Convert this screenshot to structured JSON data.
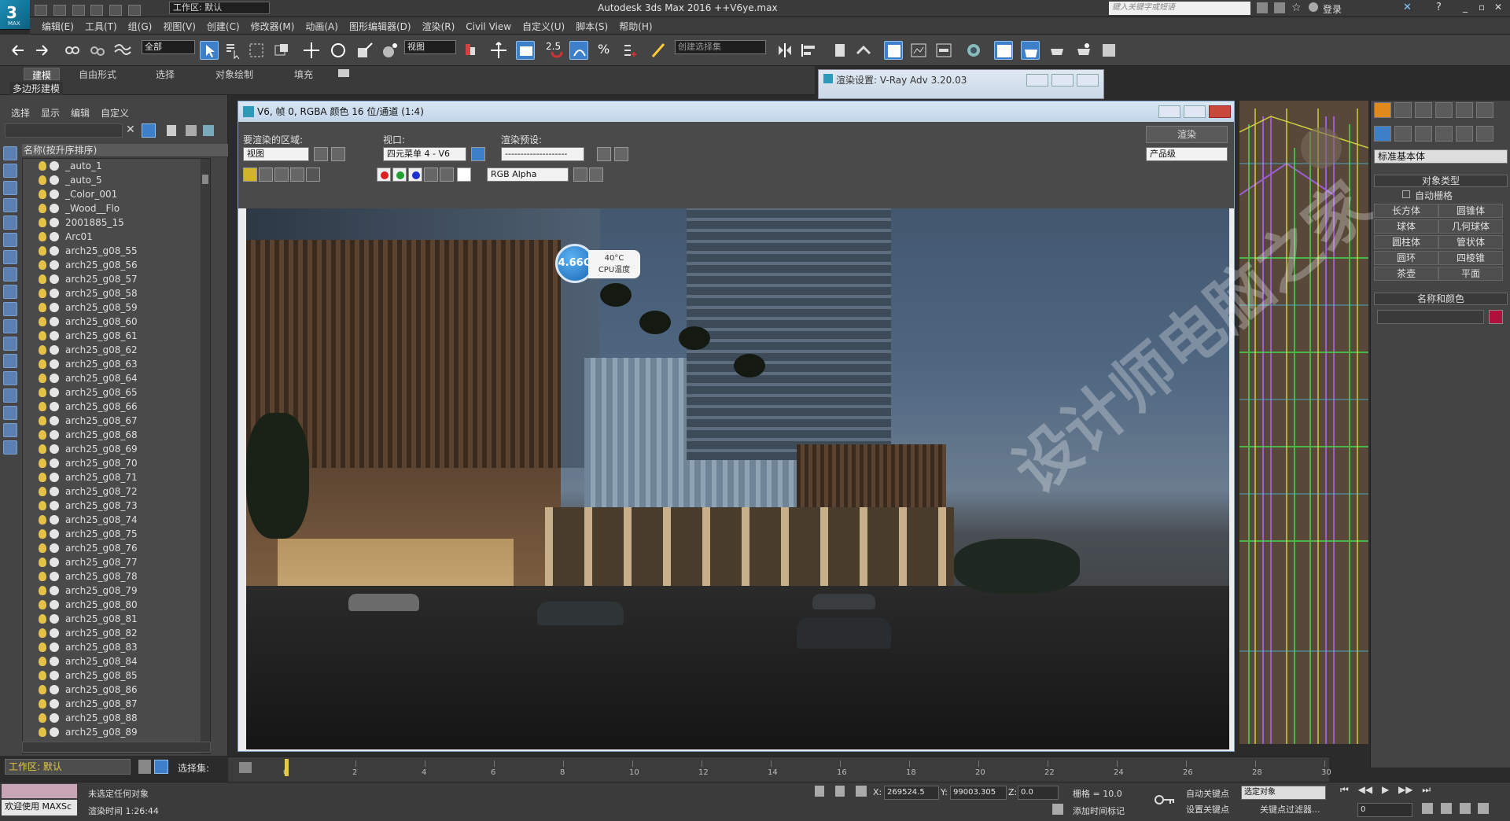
{
  "app": {
    "title": "Autodesk 3ds Max 2016    ++V6ye.max",
    "workspace_label": "工作区: 默认",
    "search_placeholder": "键入关键字或短语",
    "login": "登录",
    "logo_small": "MAX"
  },
  "menu": [
    "编辑(E)",
    "工具(T)",
    "组(G)",
    "视图(V)",
    "创建(C)",
    "修改器(M)",
    "动画(A)",
    "图形编辑器(D)",
    "渲染(R)",
    "Civil View",
    "自定义(U)",
    "脚本(S)",
    "帮助(H)"
  ],
  "toolbar": {
    "filter_select": "全部",
    "ref_coord_select": "视图",
    "named_selection": "创建选择集",
    "snap_label": "2.5"
  },
  "ribbon": {
    "tabs": [
      "建模",
      "自由形式",
      "选择",
      "对象绘制",
      "填充"
    ],
    "sub_label": "多边形建模"
  },
  "explorer": {
    "menu": [
      "选择",
      "显示",
      "编辑",
      "自定义"
    ],
    "header": "名称(按升序排序)",
    "items": [
      "_auto_1",
      "_auto_5",
      "_Color_001",
      "_Wood__Flo",
      "2001885_15",
      "Arc01",
      "arch25_g08_55",
      "arch25_g08_56",
      "arch25_g08_57",
      "arch25_g08_58",
      "arch25_g08_59",
      "arch25_g08_60",
      "arch25_g08_61",
      "arch25_g08_62",
      "arch25_g08_63",
      "arch25_g08_64",
      "arch25_g08_65",
      "arch25_g08_66",
      "arch25_g08_67",
      "arch25_g08_68",
      "arch25_g08_69",
      "arch25_g08_70",
      "arch25_g08_71",
      "arch25_g08_72",
      "arch25_g08_73",
      "arch25_g08_74",
      "arch25_g08_75",
      "arch25_g08_76",
      "arch25_g08_77",
      "arch25_g08_78",
      "arch25_g08_79",
      "arch25_g08_80",
      "arch25_g08_81",
      "arch25_g08_82",
      "arch25_g08_83",
      "arch25_g08_84",
      "arch25_g08_85",
      "arch25_g08_86",
      "arch25_g08_87",
      "arch25_g08_88",
      "arch25_g08_89"
    ],
    "workspace": "工作区: 默认",
    "selection_set": "选择集:"
  },
  "render_window": {
    "title": "V6, 帧 0, RGBA 颜色 16 位/通道 (1:4)",
    "area_label": "要渲染的区域:",
    "area_value": "视图",
    "viewport_label": "视口:",
    "viewport_value": "四元菜单 4 - V6",
    "preset_label": "渲染预设:",
    "preset_value": "--------------------",
    "render_button": "渲染",
    "quality_value": "产品级",
    "channel_value": "RGB Alpha"
  },
  "temp_widget": {
    "value": "4.66G",
    "temp": "40°C",
    "label": "CPU温度"
  },
  "render_settings_window": {
    "title": "渲染设置: V-Ray Adv 3.20.03"
  },
  "command_panel": {
    "category_select": "标准基本体",
    "object_type_rollout": "对象类型",
    "autogrid": "自动栅格",
    "buttons": [
      "长方体",
      "圆锥体",
      "球体",
      "几何球体",
      "圆柱体",
      "管状体",
      "圆环",
      "四棱锥",
      "茶壶",
      "平面"
    ],
    "name_color_rollout": "名称和颜色",
    "swatch_color": "#b0103c"
  },
  "timeline": {
    "ticks": [
      "0",
      "2",
      "4",
      "6",
      "8",
      "10",
      "12",
      "14",
      "16",
      "18",
      "20",
      "22",
      "24",
      "26",
      "28",
      "30"
    ]
  },
  "status": {
    "welcome": "欢迎使用 MAXSc",
    "no_selection": "未选定任何对象",
    "render_time": "渲染时间 1:26:44",
    "x_value": "269524.5",
    "y_value": "99003.305",
    "z_value": "0.0",
    "grid": "栅格 = 10.0",
    "add_time_tag": "添加时间标记",
    "auto_key": "自动关键点",
    "set_key": "设置关键点",
    "selected_obj": "选定对象",
    "key_filters": "关键点过滤器...",
    "frame_value": "0",
    "x_label": "X:",
    "y_label": "Y:",
    "z_label": "Z:"
  },
  "watermark": "设计师电脑之家",
  "colors": {
    "accent": "#1d8fb8",
    "panel": "#444444",
    "viewport_lines": "#9b59d6"
  }
}
